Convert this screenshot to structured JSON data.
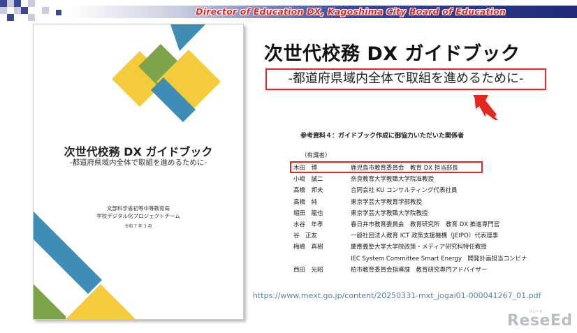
{
  "banner": {
    "title": "Director of Education DX, Kagoshima City Board of Education",
    "accent_color": "#e3281f"
  },
  "cover": {
    "title": "次世代校務 DX ガイドブック",
    "subtitle": "-都道府県域内全体で取組を進めるために-",
    "org_line1": "文部科学省初等中等教育局",
    "org_line2": "学校デジタル化プロジェクトチーム",
    "date": "令和 7 年 3 月"
  },
  "slide": {
    "title": "次世代校務 DX ガイドブック",
    "subtitle": "-都道府県域内全体で取組を進めるために-"
  },
  "reference": {
    "heading": "参考資料４：ガイドブック作成に御協力いただいた関係者",
    "group_label": "（有識者）",
    "members": [
      {
        "name": "木田　博",
        "affiliation": "鹿児島市教育委員会　教育 DX 担当部長"
      },
      {
        "name": "小﨑　誠二",
        "affiliation": "奈良教育大学教職大学院准教授"
      },
      {
        "name": "髙橋　邦夫",
        "affiliation": "合同会社 KU コンサルティング代表社員"
      },
      {
        "name": "高橋　純",
        "affiliation": "東京学芸大学教育学部教授"
      },
      {
        "name": "堀田　龍也",
        "affiliation": "東京学芸大学教職大学院教授"
      },
      {
        "name": "水谷　年孝",
        "affiliation": "春日井市教育委員会　教育研究所　教育 DX 推進専門官"
      },
      {
        "name": "谷　正友",
        "affiliation": "一般社団法人教育 ICT 政策支援機構（JEIPO）代表理事"
      },
      {
        "name": "梅嶋　真樹",
        "affiliation": "慶應義塾大学大学院政策・メディア研究科特任教授"
      },
      {
        "name": "",
        "affiliation": "IEC System Committee Smart Energy　開発計画担当コンビナ"
      },
      {
        "name": "西田　光昭",
        "affiliation": "柏市教育委員会指導課　教育研究専門アドバイザー"
      }
    ]
  },
  "source": {
    "url": "https://www.mext.go.jp/content/20250331-mxt_jogai01-000041267_01.pdf"
  },
  "logo": {
    "text": "ReseEd",
    "subtext": "リシード"
  }
}
